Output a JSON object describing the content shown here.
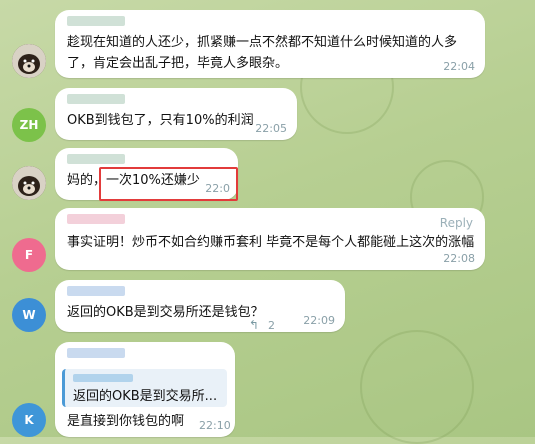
{
  "messages": [
    {
      "avatar": "dog-avatar",
      "text_lines": [
        "趁现在知道的人还少，抓紧赚一点不然都不知道什么时候知道的人多",
        "了，肯定会出乱子把，毕竟人多眼杂。"
      ],
      "time": "22:04"
    },
    {
      "avatar_initials": "ZH",
      "avatar_color": "#7cc24a",
      "text": "OKB到钱包了，只有10%的利润",
      "time": "22:05"
    },
    {
      "avatar": "dog-avatar",
      "text_prefix": "妈的，",
      "text_highlight": "一次10%还嫌少",
      "time": "22:0"
    },
    {
      "avatar_initials": "F",
      "avatar_color": "#ef6b8f",
      "reply_label": "Reply",
      "text": "事实证明！炒币不如合约赚币套利 毕竟不是每个人都能碰上这次的涨幅",
      "time": "22:08"
    },
    {
      "avatar_initials": "W",
      "avatar_color": "#3c8fd6",
      "text": "返回的OKB是到交易所还是钱包？",
      "replies": "2",
      "time": "22:09"
    },
    {
      "avatar_initials": "K",
      "avatar_color": "#3f96d8",
      "quote_text": "返回的OKB是到交易所...",
      "text": "是直接到你钱包的啊",
      "time": "22:10"
    }
  ]
}
